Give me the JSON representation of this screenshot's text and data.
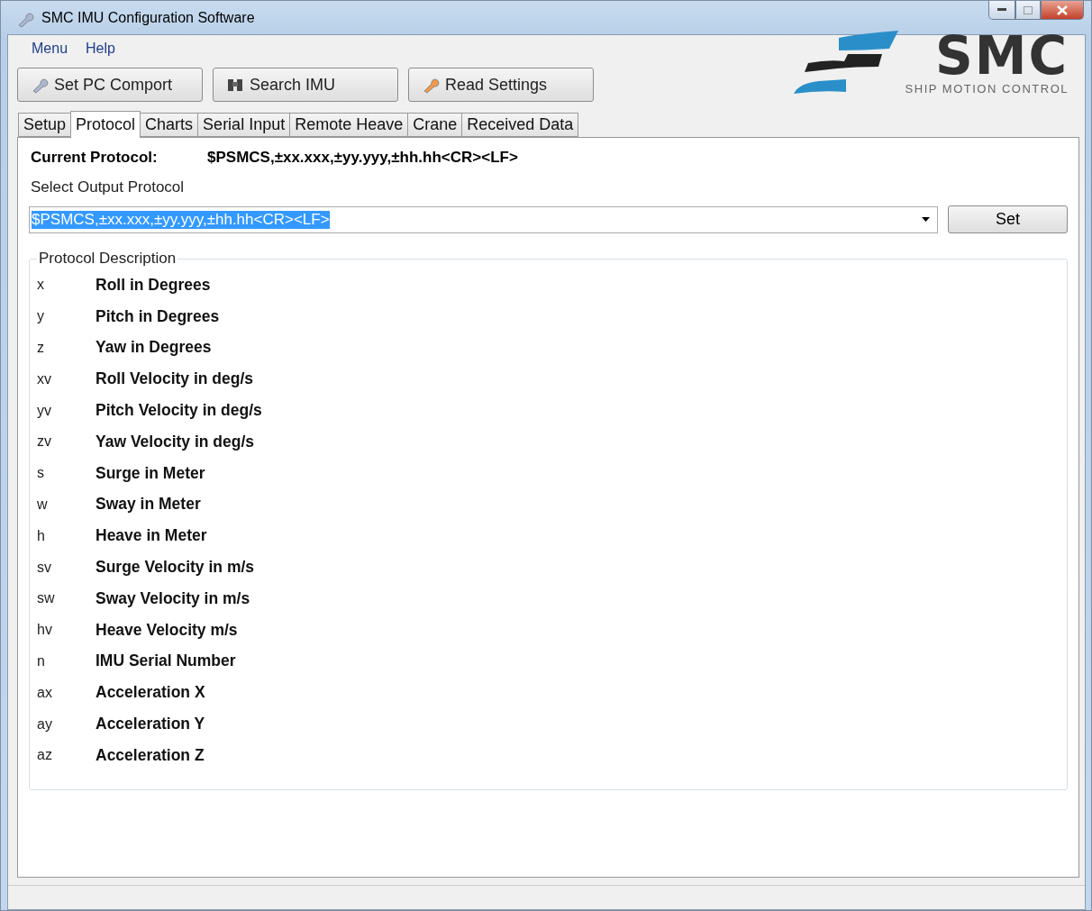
{
  "window": {
    "title": "SMC IMU Configuration Software"
  },
  "menu": [
    "Menu",
    "Help"
  ],
  "toolbar": [
    {
      "label": "Set PC Comport",
      "kind": "wrench"
    },
    {
      "label": "Search IMU",
      "kind": "binoculars"
    },
    {
      "label": "Read Settings",
      "kind": "wrench-orange"
    }
  ],
  "logo": {
    "name": "SMC",
    "tagline": "SHIP MOTION CONTROL"
  },
  "tabs": [
    {
      "label": "Setup",
      "selected": false
    },
    {
      "label": "Protocol",
      "selected": true
    },
    {
      "label": "Charts",
      "selected": false
    },
    {
      "label": "Serial Input",
      "selected": false
    },
    {
      "label": "Remote Heave",
      "selected": false
    },
    {
      "label": "Crane",
      "selected": false
    },
    {
      "label": "Received Data",
      "selected": false
    }
  ],
  "current_protocol": {
    "label": "Current Protocol:",
    "value": "$PSMCS,±xx.xxx,±yy.yyy,±hh.hh<CR><LF>"
  },
  "select_output": {
    "label": "Select Output Protocol",
    "value": "$PSMCS,±xx.xxx,±yy.yyy,±hh.hh<CR><LF>",
    "text_selected": true,
    "button": "Set"
  },
  "protocol_description": {
    "title": "Protocol Description",
    "rows": [
      {
        "symbol": "x",
        "description": "Roll in Degrees"
      },
      {
        "symbol": "y",
        "description": "Pitch in Degrees"
      },
      {
        "symbol": "z",
        "description": "Yaw in Degrees"
      },
      {
        "symbol": "xv",
        "description": "Roll Velocity in deg/s"
      },
      {
        "symbol": "yv",
        "description": "Pitch Velocity in deg/s"
      },
      {
        "symbol": "zv",
        "description": "Yaw Velocity in deg/s"
      },
      {
        "symbol": "s",
        "description": "Surge in Meter"
      },
      {
        "symbol": "w",
        "description": "Sway in Meter"
      },
      {
        "symbol": "h",
        "description": "Heave in Meter"
      },
      {
        "symbol": "sv",
        "description": "Surge Velocity in m/s"
      },
      {
        "symbol": "sw",
        "description": "Sway Velocity in m/s"
      },
      {
        "symbol": "hv",
        "description": "Heave Velocity m/s"
      },
      {
        "symbol": "n",
        "description": "IMU Serial Number"
      },
      {
        "symbol": "ax",
        "description": "Acceleration X"
      },
      {
        "symbol": "ay",
        "description": "Acceleration Y"
      },
      {
        "symbol": "az",
        "description": "Acceleration Z"
      }
    ]
  }
}
